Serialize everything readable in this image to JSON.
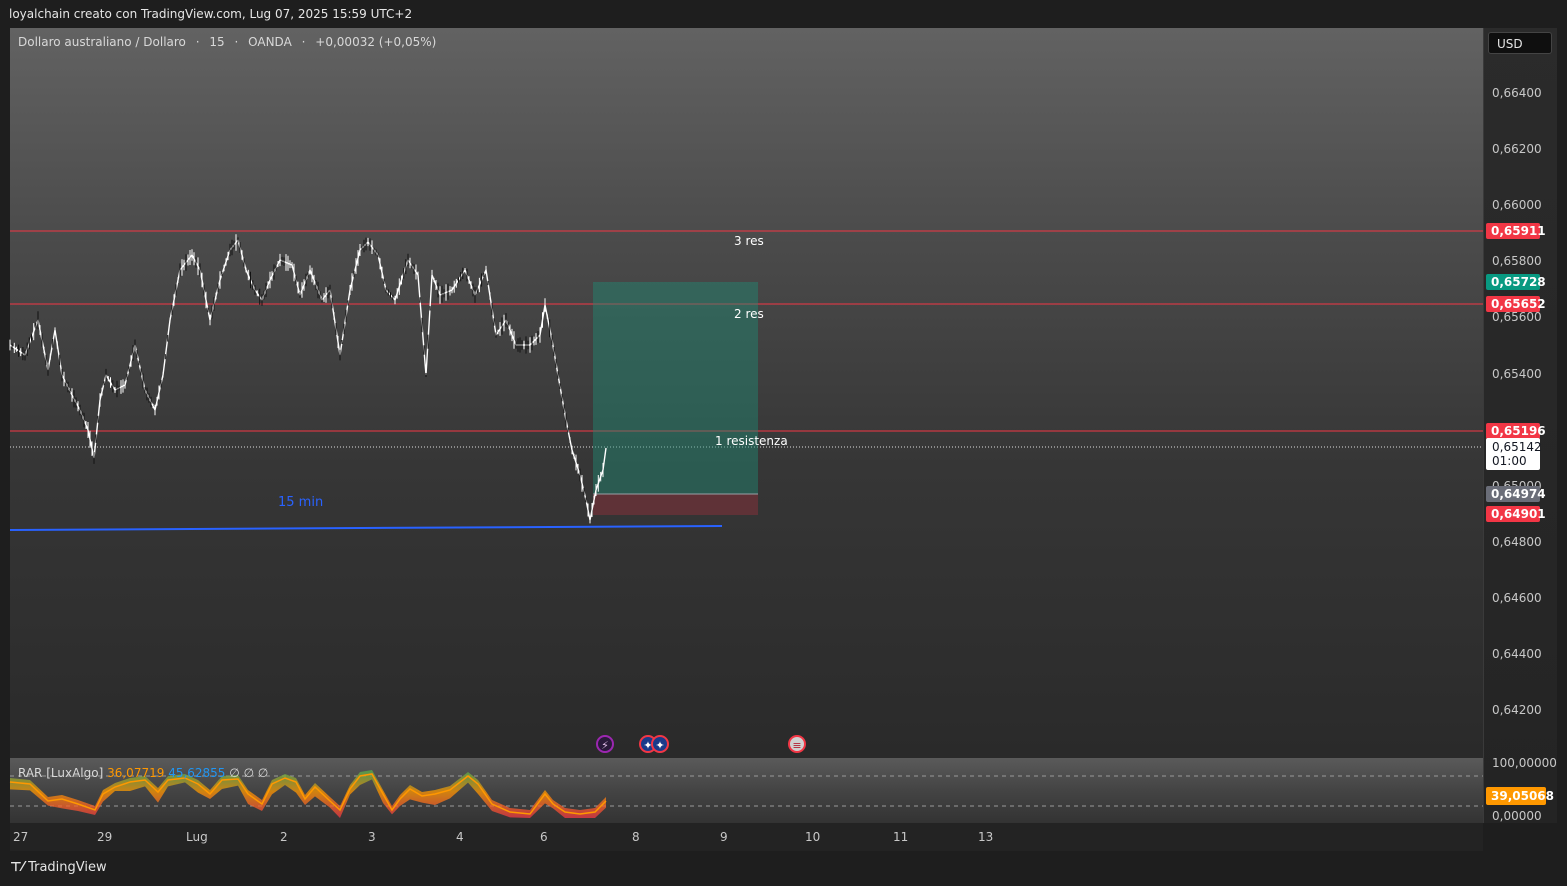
{
  "header": {
    "credit": "loyalchain creato con TradingView.com, Lug 07, 2025 15:59 UTC+2"
  },
  "legend": {
    "symbol": "Dollaro australiano / Dollaro",
    "interval": "15",
    "source": "OANDA",
    "separator": "·",
    "change": "+0,00032 (+0,05%)"
  },
  "currency": "USD",
  "price_axis": {
    "ticks": [
      "0,66400",
      "0,66200",
      "0,66000",
      "0,65800",
      "0,65600",
      "0,65400",
      "0,65000",
      "0,64800",
      "0,64600",
      "0,64400",
      "0,64200"
    ]
  },
  "price_tags": {
    "res3": "0,65911",
    "target": "0,65728",
    "res2": "0,65652",
    "res1": "0,65196",
    "current_price": "0,65142",
    "countdown": "01:00",
    "entry": "0,64974",
    "stop": "0,64901"
  },
  "annotations": {
    "res3": "3 res",
    "res2": "2 res",
    "res1": "1 resistenza",
    "trendline": "15 min"
  },
  "oscillator": {
    "name": "RAR [LuxAlgo]",
    "value1": "36,07719",
    "value2": "45,62855",
    "empty1": "∅",
    "empty2": "∅",
    "empty3": "∅",
    "axis_top": "100,00000",
    "axis_bottom": "0,00000",
    "current": "39,05068"
  },
  "time_axis": {
    "labels": [
      "27",
      "29",
      "Lug",
      "2",
      "3",
      "4",
      "6",
      "8",
      "9",
      "10",
      "11",
      "13"
    ]
  },
  "events": {
    "icons": [
      "lightning-icon",
      "australia-flag-icon",
      "australia-flag-icon",
      "us-flag-icon"
    ]
  },
  "footer": {
    "brand": "TradingView"
  },
  "colors": {
    "resistance": "#f23645",
    "target_green": "#089981",
    "trendline": "#2962ff",
    "oscillator_orange": "#ff9800",
    "oscillator_blue": "#2196f3"
  }
}
